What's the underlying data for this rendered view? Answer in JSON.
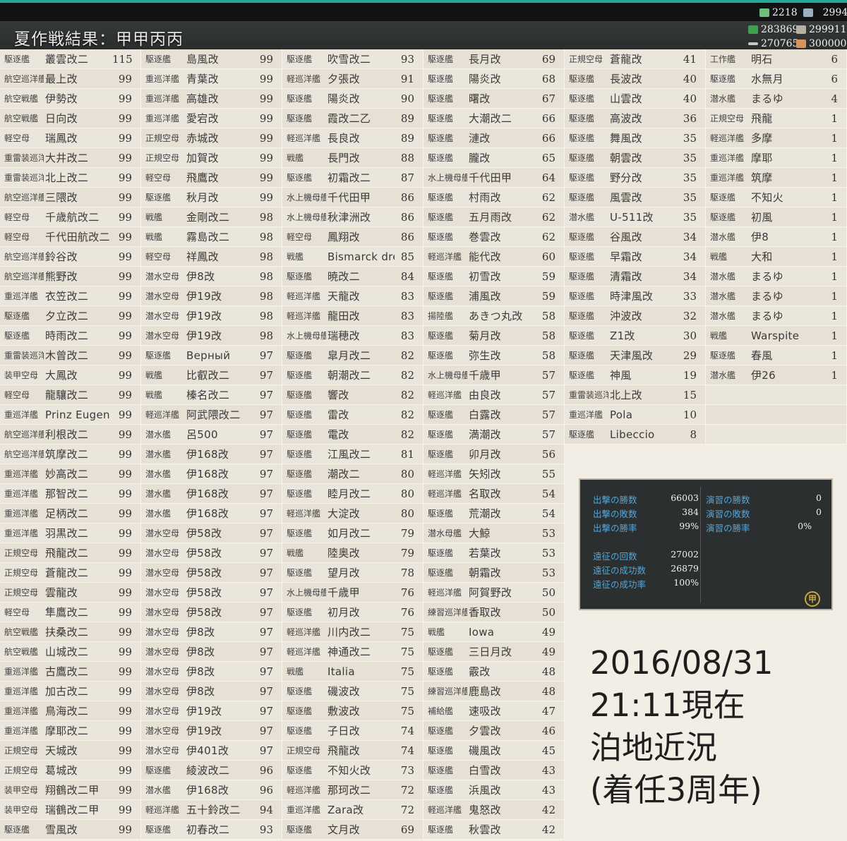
{
  "title": "夏作戦結果：甲甲丙丙",
  "resources": {
    "buckets": "2218",
    "dev": "2994",
    "fuel": "283869",
    "ammo": "299911",
    "steel": "270765",
    "bauxite": "300000"
  },
  "columns": [
    [
      [
        "駆逐艦",
        "叢雲改二",
        "115"
      ],
      [
        "航空巡洋艦",
        "最上改",
        "99"
      ],
      [
        "航空戦艦",
        "伊勢改",
        "99"
      ],
      [
        "航空戦艦",
        "日向改",
        "99"
      ],
      [
        "軽空母",
        "瑞鳳改",
        "99"
      ],
      [
        "重雷装巡洋艦",
        "大井改二",
        "99"
      ],
      [
        "重雷装巡洋艦",
        "北上改二",
        "99"
      ],
      [
        "航空巡洋艦",
        "三隈改",
        "99"
      ],
      [
        "軽空母",
        "千歳航改二",
        "99"
      ],
      [
        "軽空母",
        "千代田航改二",
        "99"
      ],
      [
        "航空巡洋艦",
        "鈴谷改",
        "99"
      ],
      [
        "航空巡洋艦",
        "熊野改",
        "99"
      ],
      [
        "重巡洋艦",
        "衣笠改二",
        "99"
      ],
      [
        "駆逐艦",
        "夕立改二",
        "99"
      ],
      [
        "駆逐艦",
        "時雨改二",
        "99"
      ],
      [
        "重雷装巡洋艦",
        "木曾改二",
        "99"
      ],
      [
        "装甲空母",
        "大鳳改",
        "99"
      ],
      [
        "軽空母",
        "龍驤改二",
        "99"
      ],
      [
        "重巡洋艦",
        "Prinz Eugen",
        "99"
      ],
      [
        "航空巡洋艦",
        "利根改二",
        "99"
      ],
      [
        "航空巡洋艦",
        "筑摩改二",
        "99"
      ],
      [
        "重巡洋艦",
        "妙高改二",
        "99"
      ],
      [
        "重巡洋艦",
        "那智改二",
        "99"
      ],
      [
        "重巡洋艦",
        "足柄改二",
        "99"
      ],
      [
        "重巡洋艦",
        "羽黒改二",
        "99"
      ],
      [
        "正規空母",
        "飛龍改二",
        "99"
      ],
      [
        "正規空母",
        "蒼龍改二",
        "99"
      ],
      [
        "正規空母",
        "雲龍改",
        "99"
      ],
      [
        "軽空母",
        "隼鷹改二",
        "99"
      ],
      [
        "航空戦艦",
        "扶桑改二",
        "99"
      ],
      [
        "航空戦艦",
        "山城改二",
        "99"
      ],
      [
        "重巡洋艦",
        "古鷹改二",
        "99"
      ],
      [
        "重巡洋艦",
        "加古改二",
        "99"
      ],
      [
        "重巡洋艦",
        "鳥海改二",
        "99"
      ],
      [
        "重巡洋艦",
        "摩耶改二",
        "99"
      ],
      [
        "正規空母",
        "天城改",
        "99"
      ],
      [
        "正規空母",
        "葛城改",
        "99"
      ],
      [
        "装甲空母",
        "翔鶴改二甲",
        "99"
      ],
      [
        "装甲空母",
        "瑞鶴改二甲",
        "99"
      ],
      [
        "駆逐艦",
        "雪風改",
        "99"
      ]
    ],
    [
      [
        "駆逐艦",
        "島風改",
        "99"
      ],
      [
        "重巡洋艦",
        "青葉改",
        "99"
      ],
      [
        "重巡洋艦",
        "高雄改",
        "99"
      ],
      [
        "重巡洋艦",
        "愛宕改",
        "99"
      ],
      [
        "正規空母",
        "赤城改",
        "99"
      ],
      [
        "正規空母",
        "加賀改",
        "99"
      ],
      [
        "軽空母",
        "飛鷹改",
        "99"
      ],
      [
        "駆逐艦",
        "秋月改",
        "99"
      ],
      [
        "戦艦",
        "金剛改二",
        "98"
      ],
      [
        "戦艦",
        "霧島改二",
        "98"
      ],
      [
        "軽空母",
        "祥鳳改",
        "98"
      ],
      [
        "潜水空母",
        "伊8改",
        "98"
      ],
      [
        "潜水空母",
        "伊19改",
        "98"
      ],
      [
        "潜水空母",
        "伊19改",
        "98"
      ],
      [
        "潜水空母",
        "伊19改",
        "98"
      ],
      [
        "駆逐艦",
        "Верный",
        "97"
      ],
      [
        "戦艦",
        "比叡改二",
        "97"
      ],
      [
        "戦艦",
        "榛名改二",
        "97"
      ],
      [
        "軽巡洋艦",
        "阿武隈改二",
        "97"
      ],
      [
        "潜水艦",
        "呂500",
        "97"
      ],
      [
        "潜水艦",
        "伊168改",
        "97"
      ],
      [
        "潜水艦",
        "伊168改",
        "97"
      ],
      [
        "潜水艦",
        "伊168改",
        "97"
      ],
      [
        "潜水艦",
        "伊168改",
        "97"
      ],
      [
        "潜水空母",
        "伊58改",
        "97"
      ],
      [
        "潜水空母",
        "伊58改",
        "97"
      ],
      [
        "潜水空母",
        "伊58改",
        "97"
      ],
      [
        "潜水空母",
        "伊58改",
        "97"
      ],
      [
        "潜水空母",
        "伊58改",
        "97"
      ],
      [
        "潜水空母",
        "伊8改",
        "97"
      ],
      [
        "潜水空母",
        "伊8改",
        "97"
      ],
      [
        "潜水空母",
        "伊8改",
        "97"
      ],
      [
        "潜水空母",
        "伊8改",
        "97"
      ],
      [
        "潜水空母",
        "伊19改",
        "97"
      ],
      [
        "潜水空母",
        "伊19改",
        "97"
      ],
      [
        "潜水空母",
        "伊401改",
        "97"
      ],
      [
        "駆逐艦",
        "綾波改二",
        "96"
      ],
      [
        "潜水艦",
        "伊168改",
        "96"
      ],
      [
        "軽巡洋艦",
        "五十鈴改二",
        "94"
      ],
      [
        "駆逐艦",
        "初春改二",
        "93"
      ]
    ],
    [
      [
        "駆逐艦",
        "吹雪改二",
        "93"
      ],
      [
        "軽巡洋艦",
        "夕張改",
        "91"
      ],
      [
        "駆逐艦",
        "陽炎改",
        "90"
      ],
      [
        "駆逐艦",
        "霞改二乙",
        "89"
      ],
      [
        "軽巡洋艦",
        "長良改",
        "89"
      ],
      [
        "戦艦",
        "長門改",
        "88"
      ],
      [
        "駆逐艦",
        "初霜改二",
        "87"
      ],
      [
        "水上機母艦",
        "千代田甲",
        "86"
      ],
      [
        "水上機母艦",
        "秋津洲改",
        "86"
      ],
      [
        "軽空母",
        "鳳翔改",
        "86"
      ],
      [
        "戦艦",
        "Bismarck drei",
        "85"
      ],
      [
        "駆逐艦",
        "暁改二",
        "84"
      ],
      [
        "軽巡洋艦",
        "天龍改",
        "83"
      ],
      [
        "軽巡洋艦",
        "龍田改",
        "83"
      ],
      [
        "水上機母艦",
        "瑞穂改",
        "83"
      ],
      [
        "駆逐艦",
        "皐月改二",
        "82"
      ],
      [
        "駆逐艦",
        "朝潮改二",
        "82"
      ],
      [
        "駆逐艦",
        "響改",
        "82"
      ],
      [
        "駆逐艦",
        "雷改",
        "82"
      ],
      [
        "駆逐艦",
        "電改",
        "82"
      ],
      [
        "駆逐艦",
        "江風改二",
        "81"
      ],
      [
        "駆逐艦",
        "潮改二",
        "80"
      ],
      [
        "駆逐艦",
        "睦月改二",
        "80"
      ],
      [
        "軽巡洋艦",
        "大淀改",
        "80"
      ],
      [
        "駆逐艦",
        "如月改二",
        "79"
      ],
      [
        "戦艦",
        "陸奥改",
        "79"
      ],
      [
        "駆逐艦",
        "望月改",
        "78"
      ],
      [
        "水上機母艦",
        "千歳甲",
        "76"
      ],
      [
        "駆逐艦",
        "初月改",
        "76"
      ],
      [
        "軽巡洋艦",
        "川内改二",
        "75"
      ],
      [
        "軽巡洋艦",
        "神通改二",
        "75"
      ],
      [
        "戦艦",
        "Italia",
        "75"
      ],
      [
        "駆逐艦",
        "磯波改",
        "75"
      ],
      [
        "駆逐艦",
        "敷波改",
        "75"
      ],
      [
        "駆逐艦",
        "子日改",
        "74"
      ],
      [
        "正規空母",
        "飛龍改",
        "74"
      ],
      [
        "駆逐艦",
        "不知火改",
        "73"
      ],
      [
        "軽巡洋艦",
        "那珂改二",
        "72"
      ],
      [
        "重巡洋艦",
        "Zara改",
        "72"
      ],
      [
        "駆逐艦",
        "文月改",
        "69"
      ]
    ],
    [
      [
        "駆逐艦",
        "長月改",
        "69"
      ],
      [
        "駆逐艦",
        "陽炎改",
        "68"
      ],
      [
        "駆逐艦",
        "曙改",
        "67"
      ],
      [
        "駆逐艦",
        "大潮改二",
        "66"
      ],
      [
        "駆逐艦",
        "漣改",
        "66"
      ],
      [
        "駆逐艦",
        "朧改",
        "65"
      ],
      [
        "水上機母艦",
        "千代田甲",
        "64"
      ],
      [
        "駆逐艦",
        "村雨改",
        "62"
      ],
      [
        "駆逐艦",
        "五月雨改",
        "62"
      ],
      [
        "駆逐艦",
        "巻雲改",
        "62"
      ],
      [
        "軽巡洋艦",
        "能代改",
        "60"
      ],
      [
        "駆逐艦",
        "初雪改",
        "59"
      ],
      [
        "駆逐艦",
        "浦風改",
        "59"
      ],
      [
        "揚陸艦",
        "あきつ丸改",
        "58"
      ],
      [
        "駆逐艦",
        "菊月改",
        "58"
      ],
      [
        "駆逐艦",
        "弥生改",
        "58"
      ],
      [
        "水上機母艦",
        "千歳甲",
        "57"
      ],
      [
        "軽巡洋艦",
        "由良改",
        "57"
      ],
      [
        "駆逐艦",
        "白露改",
        "57"
      ],
      [
        "駆逐艦",
        "満潮改",
        "57"
      ],
      [
        "駆逐艦",
        "卯月改",
        "56"
      ],
      [
        "軽巡洋艦",
        "矢矧改",
        "55"
      ],
      [
        "軽巡洋艦",
        "名取改",
        "54"
      ],
      [
        "駆逐艦",
        "荒潮改",
        "54"
      ],
      [
        "潜水母艦",
        "大鯨",
        "53"
      ],
      [
        "駆逐艦",
        "若葉改",
        "53"
      ],
      [
        "駆逐艦",
        "朝霜改",
        "53"
      ],
      [
        "軽巡洋艦",
        "阿賀野改",
        "50"
      ],
      [
        "練習巡洋艦",
        "香取改",
        "50"
      ],
      [
        "戦艦",
        "Iowa",
        "49"
      ],
      [
        "駆逐艦",
        "三日月改",
        "49"
      ],
      [
        "駆逐艦",
        "霰改",
        "48"
      ],
      [
        "練習巡洋艦",
        "鹿島改",
        "48"
      ],
      [
        "補給艦",
        "速吸改",
        "47"
      ],
      [
        "駆逐艦",
        "夕雲改",
        "46"
      ],
      [
        "駆逐艦",
        "磯風改",
        "45"
      ],
      [
        "駆逐艦",
        "白雪改",
        "43"
      ],
      [
        "駆逐艦",
        "浜風改",
        "43"
      ],
      [
        "軽巡洋艦",
        "鬼怒改",
        "42"
      ],
      [
        "駆逐艦",
        "秋雲改",
        "42"
      ]
    ],
    [
      [
        "正規空母",
        "蒼龍改",
        "41"
      ],
      [
        "駆逐艦",
        "長波改",
        "40"
      ],
      [
        "駆逐艦",
        "山雲改",
        "40"
      ],
      [
        "駆逐艦",
        "高波改",
        "36"
      ],
      [
        "駆逐艦",
        "舞風改",
        "35"
      ],
      [
        "駆逐艦",
        "朝雲改",
        "35"
      ],
      [
        "駆逐艦",
        "野分改",
        "35"
      ],
      [
        "駆逐艦",
        "風雲改",
        "35"
      ],
      [
        "潜水艦",
        "U-511改",
        "35"
      ],
      [
        "駆逐艦",
        "谷風改",
        "34"
      ],
      [
        "駆逐艦",
        "早霜改",
        "34"
      ],
      [
        "駆逐艦",
        "清霜改",
        "34"
      ],
      [
        "駆逐艦",
        "時津風改",
        "33"
      ],
      [
        "駆逐艦",
        "沖波改",
        "32"
      ],
      [
        "駆逐艦",
        "Z1改",
        "30"
      ],
      [
        "駆逐艦",
        "天津風改",
        "29"
      ],
      [
        "駆逐艦",
        "神風",
        "19"
      ],
      [
        "重雷装巡洋艦",
        "北上改",
        "15"
      ],
      [
        "重巡洋艦",
        "Pola",
        "10"
      ],
      [
        "駆逐艦",
        "Libeccio",
        "8"
      ]
    ],
    [
      [
        "工作艦",
        "明石",
        "6"
      ],
      [
        "駆逐艦",
        "水無月",
        "6"
      ],
      [
        "潜水艦",
        "まるゆ",
        "4"
      ],
      [
        "正規空母",
        "飛龍",
        "1"
      ],
      [
        "軽巡洋艦",
        "多摩",
        "1"
      ],
      [
        "重巡洋艦",
        "摩耶",
        "1"
      ],
      [
        "重巡洋艦",
        "筑摩",
        "1"
      ],
      [
        "駆逐艦",
        "不知火",
        "1"
      ],
      [
        "駆逐艦",
        "初風",
        "1"
      ],
      [
        "潜水艦",
        "伊8",
        "1"
      ],
      [
        "戦艦",
        "大和",
        "1"
      ],
      [
        "潜水艦",
        "まるゆ",
        "1"
      ],
      [
        "潜水艦",
        "まるゆ",
        "1"
      ],
      [
        "潜水艦",
        "まるゆ",
        "1"
      ],
      [
        "戦艦",
        "Warspite",
        "1"
      ],
      [
        "駆逐艦",
        "春風",
        "1"
      ],
      [
        "潜水艦",
        "伊26",
        "1"
      ],
      [
        "",
        "",
        ""
      ],
      [
        "",
        "",
        ""
      ],
      [
        "",
        "",
        ""
      ]
    ]
  ],
  "stats": {
    "left": [
      {
        "label": "出撃の勝数",
        "value": "66003"
      },
      {
        "label": "出撃の敗数",
        "value": "384"
      },
      {
        "label": "出撃の勝率",
        "value": "99%"
      },
      {
        "label": "遠征の回数",
        "value": "27002"
      },
      {
        "label": "遠征の成功数",
        "value": "26879"
      },
      {
        "label": "遠征の成功率",
        "value": "100%"
      }
    ],
    "right": [
      {
        "label": "演習の勝数",
        "value": "0"
      },
      {
        "label": "演習の敗数",
        "value": "0"
      },
      {
        "label": "演習の勝率",
        "value": "0%"
      }
    ],
    "emblem": "甲"
  },
  "note": {
    "line1": "2016/08/31",
    "line2": "21:11現在",
    "line3": "泊地近況",
    "line4": "(着任3周年)"
  },
  "colors": {
    "accent": "#27a79a",
    "stat_label": "#4aa8e0",
    "cell_bg": "#ebe6dc",
    "emblem": "#c9a93a"
  }
}
